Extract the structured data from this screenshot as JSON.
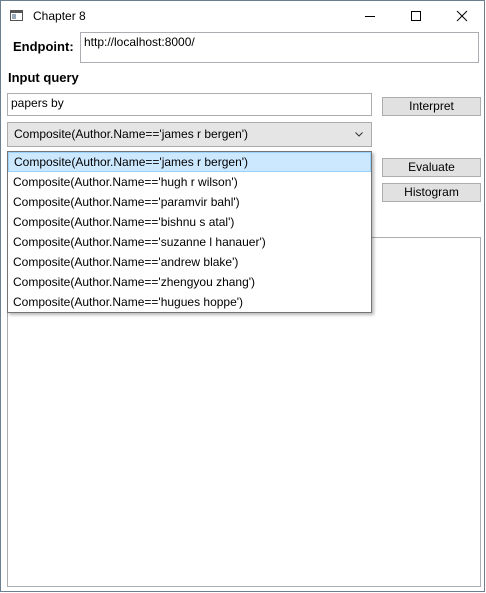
{
  "window": {
    "title": "Chapter 8"
  },
  "endpoint": {
    "label": "Endpoint:",
    "value": "http://localhost:8000/"
  },
  "query": {
    "section_label": "Input query",
    "value": "papers by"
  },
  "buttons": {
    "interpret": "Interpret",
    "evaluate": "Evaluate",
    "histogram": "Histogram"
  },
  "combo": {
    "selected": "Composite(Author.Name=='james r bergen')",
    "options": [
      "Composite(Author.Name=='james r bergen')",
      "Composite(Author.Name=='hugh r wilson')",
      "Composite(Author.Name=='paramvir bahl')",
      "Composite(Author.Name=='bishnu s atal')",
      "Composite(Author.Name=='suzanne l hanauer')",
      "Composite(Author.Name=='andrew blake')",
      "Composite(Author.Name=='zhengyou zhang')",
      "Composite(Author.Name=='hugues hoppe')"
    ]
  },
  "icons": {
    "app": "window-app-icon",
    "minimize": "minimize-icon",
    "maximize": "maximize-icon",
    "close": "close-icon",
    "dropdown": "chevron-down-icon"
  },
  "colors": {
    "selection_bg": "#cce8ff",
    "selection_border": "#99d1ff",
    "button_bg": "#e1e1e1"
  }
}
